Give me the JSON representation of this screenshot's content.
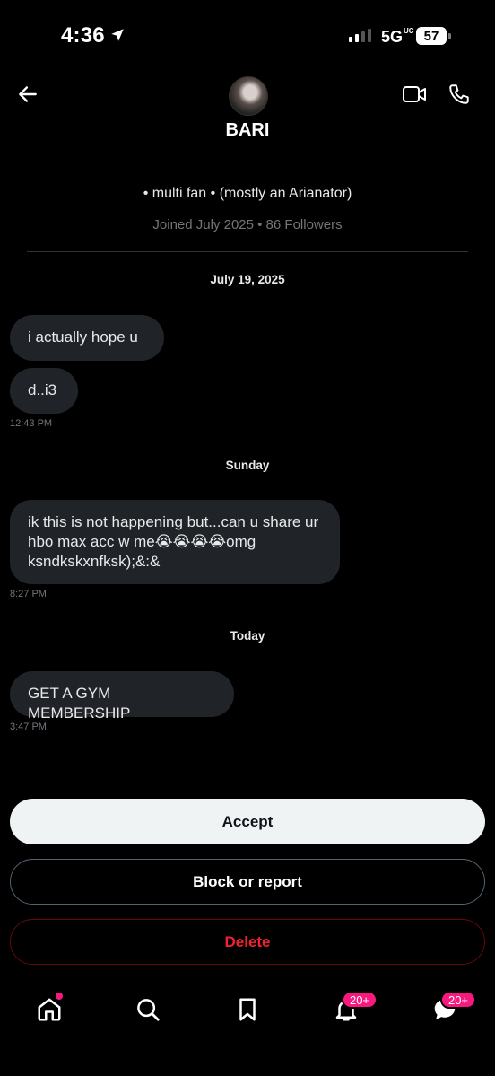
{
  "status_bar": {
    "time": "4:36",
    "network": "5G",
    "network_suffix": "UC",
    "battery": "57"
  },
  "header": {
    "name": "BARI",
    "bio": "• multi fan • (mostly an Arianator)",
    "meta": "Joined July 2025 • 86 Followers"
  },
  "conversation": {
    "groups": [
      {
        "date": "July 19, 2025",
        "messages": [
          "i actually hope u",
          "d..i3"
        ],
        "timestamp": "12:43 PM"
      },
      {
        "date": "Sunday",
        "messages": [
          "ik this is not happening but...can u share ur hbo max acc w me😭😭😭😭omg ksndkskxnfksk);&:&"
        ],
        "timestamp": "8:27 PM"
      },
      {
        "date": "Today",
        "messages": [
          "GET A GYM MEMBERSHIP"
        ],
        "timestamp": "3:47 PM"
      }
    ]
  },
  "actions": {
    "accept": "Accept",
    "block": "Block or report",
    "delete": "Delete"
  },
  "bottom_nav": {
    "notifications_badge": "20+",
    "messages_badge": "20+"
  },
  "colors": {
    "accent_pink": "#f91880",
    "delete_red": "#f4212e",
    "bubble": "#202327"
  }
}
